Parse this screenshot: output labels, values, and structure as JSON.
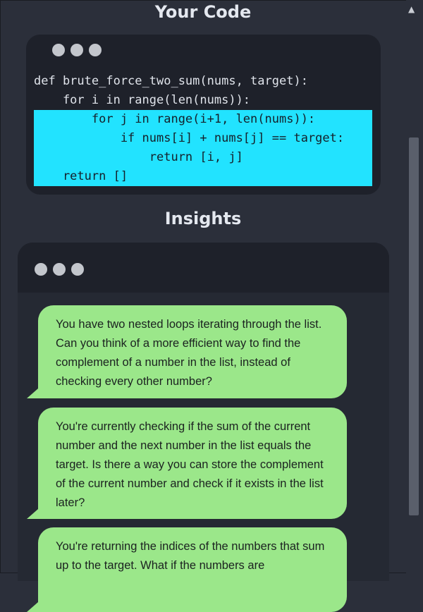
{
  "sections": {
    "code_title": "Your Code",
    "insights_title": "Insights"
  },
  "code": {
    "lines": [
      "def brute_force_two_sum(nums, target):",
      "    for i in range(len(nums)):",
      "        for j in range(i+1, len(nums)):",
      "            if nums[i] + nums[j] == target:",
      "                return [i, j]",
      "    return []"
    ],
    "highlight_color": "#22e3ff"
  },
  "insights": [
    "You have two nested loops iterating through the list. Can you think of a more efficient way to find the complement of a number in the list, instead of checking every other number?",
    "You're currently checking if the sum of the current number and the next number in the list equals the target. Is there a way you can store the complement of the current number and check if it exists in the list later?",
    "You're returning the indices of the numbers that sum up to the target. What if the numbers are"
  ],
  "colors": {
    "background": "#2b2f3a",
    "bubble": "#9be78a"
  },
  "icons": {
    "window_controls": "three-dots-icon",
    "scroll_up": "triangle-up-icon"
  }
}
